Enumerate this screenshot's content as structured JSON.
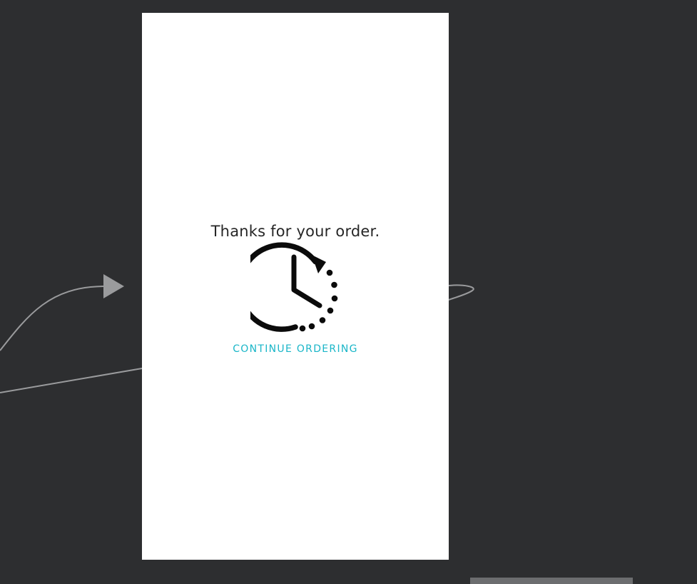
{
  "screen": {
    "message": "Thanks for your order.",
    "icon": "clock-refresh-icon",
    "continue_label": "CONTINUE ORDERING"
  },
  "colors": {
    "canvas_background": "#2d2e30",
    "screen_background": "#ffffff",
    "link_accent": "#1ab6c8",
    "connector_line": "#9a9b9d"
  }
}
